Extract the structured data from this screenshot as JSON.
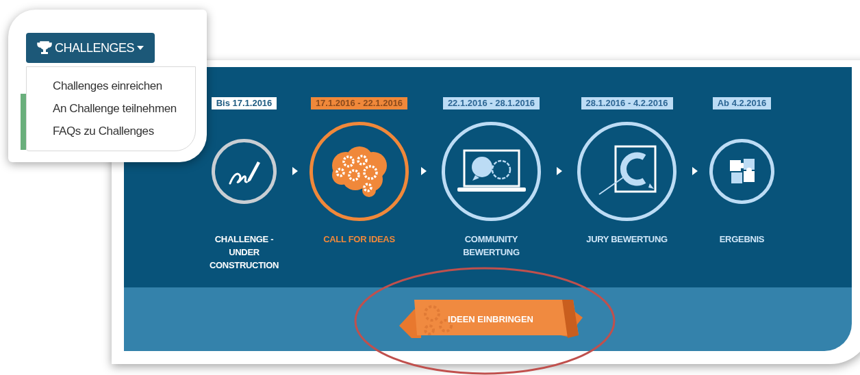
{
  "dropdown": {
    "label": "CHALLENGES",
    "expanded": true,
    "items": [
      {
        "label": "Challenges einreichen"
      },
      {
        "label": "An Challenge teilnehmen"
      },
      {
        "label": "FAQs zu Challenges"
      }
    ]
  },
  "timeline": {
    "steps": [
      {
        "date": "Bis 17.1.2016",
        "label": "CHALLENGE - UNDER CONSTRUCTION",
        "completed": true,
        "selected": false
      },
      {
        "date": "17.1.2016 - 22.1.2016",
        "label": "CALL FOR IDEAS",
        "completed": false,
        "selected": true
      },
      {
        "date": "22.1.2016 - 28.1.2016",
        "label": "COMMUNITY BEWERTUNG",
        "completed": false,
        "selected": false
      },
      {
        "date": "28.1.2016 - 4.2.2016",
        "label": "JURY BEWERTUNG",
        "completed": false,
        "selected": false
      },
      {
        "date": "Ab 4.2.2016",
        "label": "ERGEBNIS",
        "completed": false,
        "selected": false
      }
    ]
  },
  "cta": {
    "label": "IDEEN EINBRINGEN"
  }
}
